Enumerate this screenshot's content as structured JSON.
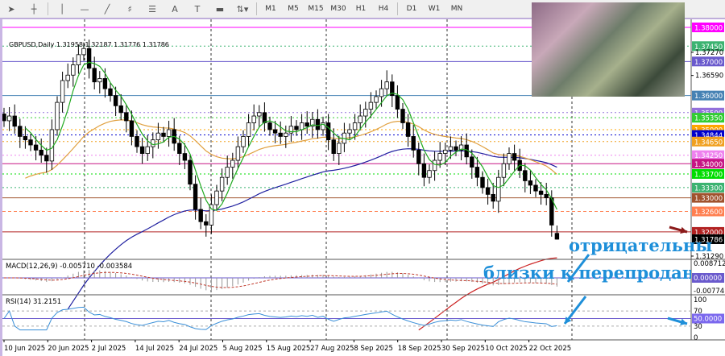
{
  "toolbar": {
    "tools": [
      "cursor-icon",
      "crosshair-icon",
      "vertical-line-icon",
      "horizontal-line-icon",
      "trendline-icon",
      "fibonacci-icon",
      "fibo-fan-icon",
      "text-icon",
      "label-icon",
      "rectangle-icon",
      "arrows-icon"
    ],
    "text_tool": "A",
    "timeframes": [
      "M1",
      "M5",
      "M15",
      "M30",
      "H1",
      "H4",
      "D1",
      "W1",
      "MN"
    ]
  },
  "chart_header": "GBPUSD,Daily  1.31958 1.32187 1.31776 1.31786",
  "annotations": {
    "line1": "отрицательны",
    "line2": "близки к перепроданности"
  },
  "chart_data": [
    {
      "type": "candlestick",
      "symbol": "GBPUSD",
      "timeframe": "Daily",
      "ylim": [
        1.31,
        1.381
      ],
      "x_tick_labels": [
        "10 Jun 2025",
        "20 Jun 2025",
        "2 Jul 2025",
        "14 Jul 2025",
        "24 Jul 2025",
        "5 Aug 2025",
        "15 Aug 2025",
        "27 Aug 2025",
        "8 Sep 2025",
        "18 Sep 2025",
        "30 Sep 2025",
        "10 Oct 2025",
        "22 Oct 2025"
      ],
      "closes": [
        1.3526,
        1.354,
        1.351,
        1.348,
        1.347,
        1.3455,
        1.344,
        1.3425,
        1.3408,
        1.35,
        1.358,
        1.3644,
        1.366,
        1.369,
        1.372,
        1.3738,
        1.368,
        1.364,
        1.365,
        1.362,
        1.36,
        1.357,
        1.355,
        1.3526,
        1.348,
        1.345,
        1.343,
        1.345,
        1.347,
        1.349,
        1.348,
        1.35,
        1.346,
        1.343,
        1.341,
        1.334,
        1.3266,
        1.323,
        1.322,
        1.328,
        1.332,
        1.336,
        1.339,
        1.341,
        1.345,
        1.348,
        1.352,
        1.354,
        1.355,
        1.352,
        1.35,
        1.349,
        1.348,
        1.349,
        1.351,
        1.35,
        1.352,
        1.351,
        1.353,
        1.35,
        1.352,
        1.347,
        1.343,
        1.346,
        1.349,
        1.35,
        1.352,
        1.354,
        1.356,
        1.358,
        1.3597,
        1.362,
        1.364,
        1.36,
        1.356,
        1.352,
        1.348,
        1.344,
        1.34,
        1.336,
        1.338,
        1.341,
        1.343,
        1.344,
        1.345,
        1.344,
        1.3455,
        1.342,
        1.339,
        1.336,
        1.333,
        1.331,
        1.329,
        1.336,
        1.34,
        1.343,
        1.341,
        1.338,
        1.335,
        1.3337,
        1.332,
        1.331,
        1.33,
        1.322,
        1.31786
      ],
      "last_bar": {
        "open": 1.31958,
        "high": 1.32187,
        "low": 1.31776,
        "close": 1.31786
      },
      "price_axis_ticks": [
        "1.37270",
        "1.36590",
        "1.31290"
      ],
      "levels": [
        {
          "price": "1.38000",
          "color": "#ff00ff",
          "style": "solid"
        },
        {
          "price": "1.37450",
          "color": "#3cb371",
          "style": "dotted"
        },
        {
          "price": "1.37000",
          "color": "#6a5acd",
          "style": "solid"
        },
        {
          "price": "1.36000",
          "color": "#4682b4",
          "style": "solid"
        },
        {
          "price": "1.35500",
          "color": "#9370db",
          "style": "dotted"
        },
        {
          "price": "1.35350",
          "color": "#32cd32",
          "style": "dotted"
        },
        {
          "price": "1.35000",
          "color": "#ffa500",
          "style": "dotted"
        },
        {
          "price": "1.34844",
          "color": "#0000cd",
          "style": "dotted"
        },
        {
          "price": "1.34650",
          "color": "#f0a020",
          "style": "dotted"
        },
        {
          "price": "1.34250",
          "color": "#ee82ee",
          "style": "dotted"
        },
        {
          "price": "1.34000",
          "color": "#c71585",
          "style": "solid"
        },
        {
          "price": "1.33700",
          "color": "#00dd00",
          "style": "dotted"
        },
        {
          "price": "1.33300",
          "color": "#3cb371",
          "style": "dotted"
        },
        {
          "price": "1.33000",
          "color": "#a0522d",
          "style": "solid"
        },
        {
          "price": "1.32600",
          "color": "#ff7f50",
          "style": "dashed"
        },
        {
          "price": "1.32000",
          "color": "#b22222",
          "style": "solid"
        },
        {
          "price": "1.31786",
          "color": "#000000",
          "style": "none"
        }
      ],
      "moving_average_colors": {
        "fast": "#22aa22",
        "medium": "#e0a040",
        "slow": "#2020a0",
        "long": "#cc2222"
      }
    },
    {
      "type": "bar",
      "title": "MACD(12,26,9) -0.005710 -0.003584",
      "axis_ticks": [
        "0.008712",
        "0.00000",
        "-0.00774"
      ],
      "macd": -0.00571,
      "signal": -0.003584
    },
    {
      "type": "line",
      "title": "RSI(14) 31.2151",
      "value": 31.2151,
      "ylim": [
        0,
        100
      ],
      "axis_ticks": [
        "100",
        "70",
        "50.0000",
        "30",
        "0"
      ],
      "color": "#3a8fd8"
    }
  ]
}
